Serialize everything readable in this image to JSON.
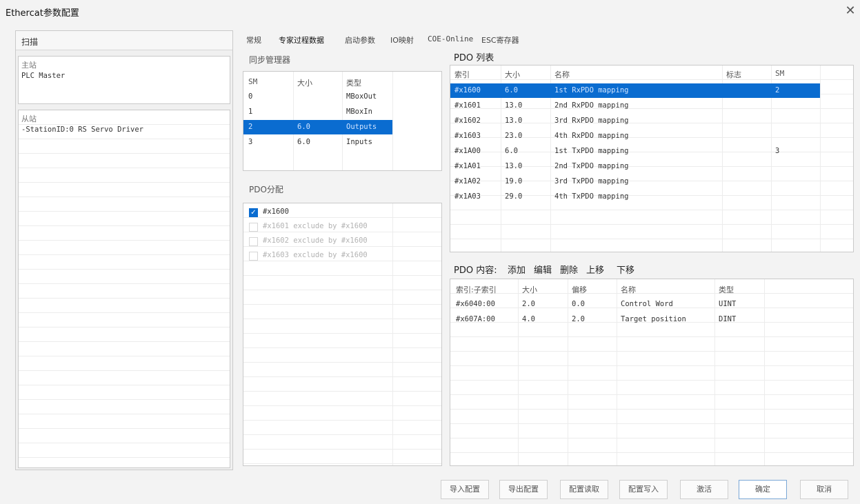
{
  "window": {
    "title": "Ethercat参数配置",
    "close_icon": "close-icon"
  },
  "left": {
    "scan_label": "扫描",
    "master_label": "主站",
    "master_name": "PLC Master",
    "slave_label": "从站",
    "slave_item": "-StationID:0 RS Servo Driver"
  },
  "tabs": [
    {
      "label": "常规"
    },
    {
      "label": "专家过程数据"
    },
    {
      "label": "启动参数"
    },
    {
      "label": "IO映射"
    },
    {
      "label": "COE-Online"
    },
    {
      "label": "ESC寄存器"
    }
  ],
  "sync_manager": {
    "title": "同步管理器",
    "columns": [
      "SM",
      "大小",
      "类型"
    ],
    "rows": [
      [
        "0",
        "",
        "MBoxOut"
      ],
      [
        "1",
        "",
        "MBoxIn"
      ],
      [
        "2",
        "6.0",
        "Outputs"
      ],
      [
        "3",
        "6.0",
        "Inputs"
      ]
    ],
    "selected_index": 2
  },
  "pdo_assign": {
    "title": "PDO分配",
    "items": [
      {
        "label": "#x1600",
        "checked": true,
        "enabled": true
      },
      {
        "label": "#x1601 exclude by #x1600",
        "checked": false,
        "enabled": false
      },
      {
        "label": "#x1602 exclude by #x1600",
        "checked": false,
        "enabled": false
      },
      {
        "label": "#x1603 exclude by #x1600",
        "checked": false,
        "enabled": false
      }
    ]
  },
  "pdo_list": {
    "title": "PDO 列表",
    "columns": [
      "索引",
      "大小",
      "名称",
      "标志",
      "SM"
    ],
    "rows": [
      [
        "#x1600",
        "6.0",
        "1st RxPDO mapping",
        "",
        "2"
      ],
      [
        "#x1601",
        "13.0",
        "2nd RxPDO mapping",
        "",
        ""
      ],
      [
        "#x1602",
        "13.0",
        "3rd RxPDO mapping",
        "",
        ""
      ],
      [
        "#x1603",
        "23.0",
        "4th RxPDO mapping",
        "",
        ""
      ],
      [
        "#x1A00",
        "6.0",
        "1st TxPDO mapping",
        "",
        "3"
      ],
      [
        "#x1A01",
        "13.0",
        "2nd TxPDO mapping",
        "",
        ""
      ],
      [
        "#x1A02",
        "19.0",
        "3rd TxPDO mapping",
        "",
        ""
      ],
      [
        "#x1A03",
        "29.0",
        "4th TxPDO mapping",
        "",
        ""
      ]
    ],
    "selected_index": 0
  },
  "pdo_content": {
    "title": "PDO 内容:",
    "actions": [
      "添加",
      "编辑",
      "删除",
      "上移",
      "下移"
    ],
    "columns": [
      "索引:子索引",
      "大小",
      "偏移",
      "名称",
      "类型"
    ],
    "rows": [
      [
        "#x6040:00",
        "2.0",
        "0.0",
        "Control Word",
        "UINT"
      ],
      [
        "#x607A:00",
        "4.0",
        "2.0",
        "Target position",
        "DINT"
      ]
    ]
  },
  "footer_buttons": [
    "导入配置",
    "导出配置",
    "配置读取",
    "配置写入",
    "激活",
    "确定",
    "取消"
  ],
  "colors": {
    "selection": "#0a6cd0",
    "checkbox": "#0a6cd0",
    "primary_border": "#7aa7d6"
  }
}
